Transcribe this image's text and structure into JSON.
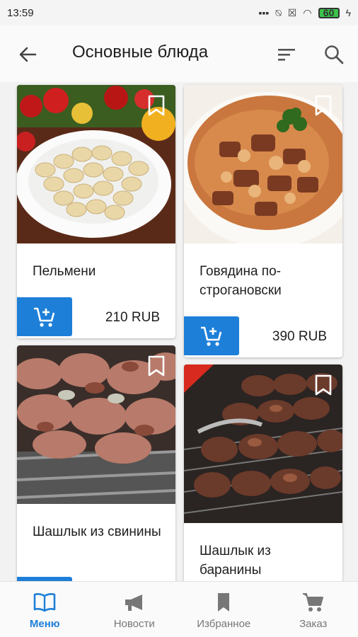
{
  "status_bar": {
    "time": "13:59",
    "battery": "60"
  },
  "app_bar": {
    "title": "Основные блюда",
    "back_icon": "arrow-back-icon",
    "sort_icon": "sort-icon",
    "search_icon": "search-icon"
  },
  "colors": {
    "accent": "#1e7fd8",
    "inactive": "#777777"
  },
  "products": [
    {
      "name": "Пельмени",
      "price": "210 RUB",
      "image": "pelmeni-photo"
    },
    {
      "name": "Говядина по-строгановски",
      "price": "390 RUB",
      "image": "beef-stroganoff-photo"
    },
    {
      "name": "Шашлык из свинины",
      "price": "",
      "image": "pork-shashlik-photo"
    },
    {
      "name": "Шашлык из баранины",
      "price": "",
      "image": "lamb-shashlik-photo"
    }
  ],
  "bottom_nav": {
    "items": [
      {
        "label": "Меню",
        "icon": "book-icon",
        "active": true
      },
      {
        "label": "Новости",
        "icon": "megaphone-icon",
        "active": false
      },
      {
        "label": "Избранное",
        "icon": "bookmark-icon",
        "active": false
      },
      {
        "label": "Заказ",
        "icon": "cart-icon",
        "active": false
      }
    ]
  }
}
